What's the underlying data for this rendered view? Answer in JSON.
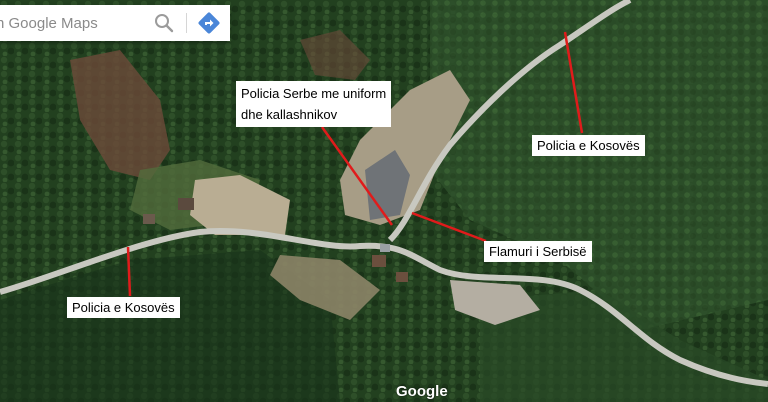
{
  "search": {
    "placeholder": "h Google Maps",
    "search_icon": "magnifier-icon",
    "directions_icon": "directions-diamond-icon"
  },
  "annotations": {
    "serb_police": "Policia Serbe me uniform\ndhe kallashnikov",
    "kosovo_police_right": "Policia e Kosovës",
    "serbian_flag": "Flamuri i Serbisë",
    "kosovo_police_left": "Policia e Kosovës"
  },
  "attribution": "Google",
  "colors": {
    "forest_dark": "#1f3a1f",
    "forest_light": "#3b5e2f",
    "road": "#c8c8c0",
    "clearing": "#b9ad93",
    "annotation_line": "#e01b1b",
    "directions_blue": "#4a86d8"
  }
}
